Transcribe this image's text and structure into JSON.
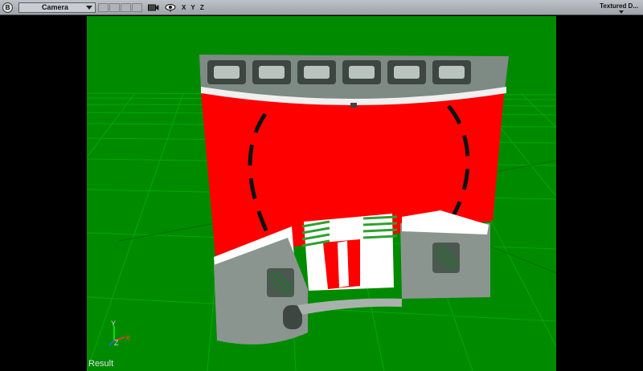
{
  "toolbar": {
    "menu_badge": "B",
    "view_selector": "Camera",
    "axes_label": "X Y Z",
    "shading_mode": "Textured D..."
  },
  "viewport": {
    "status_label": "Result",
    "gizmo": {
      "x": "X",
      "y": "Y",
      "z": "Z"
    },
    "colors": {
      "ground": "#008a00",
      "grid": "#00aa00",
      "wall": "#ff0000",
      "letterbox": "#000000"
    }
  }
}
